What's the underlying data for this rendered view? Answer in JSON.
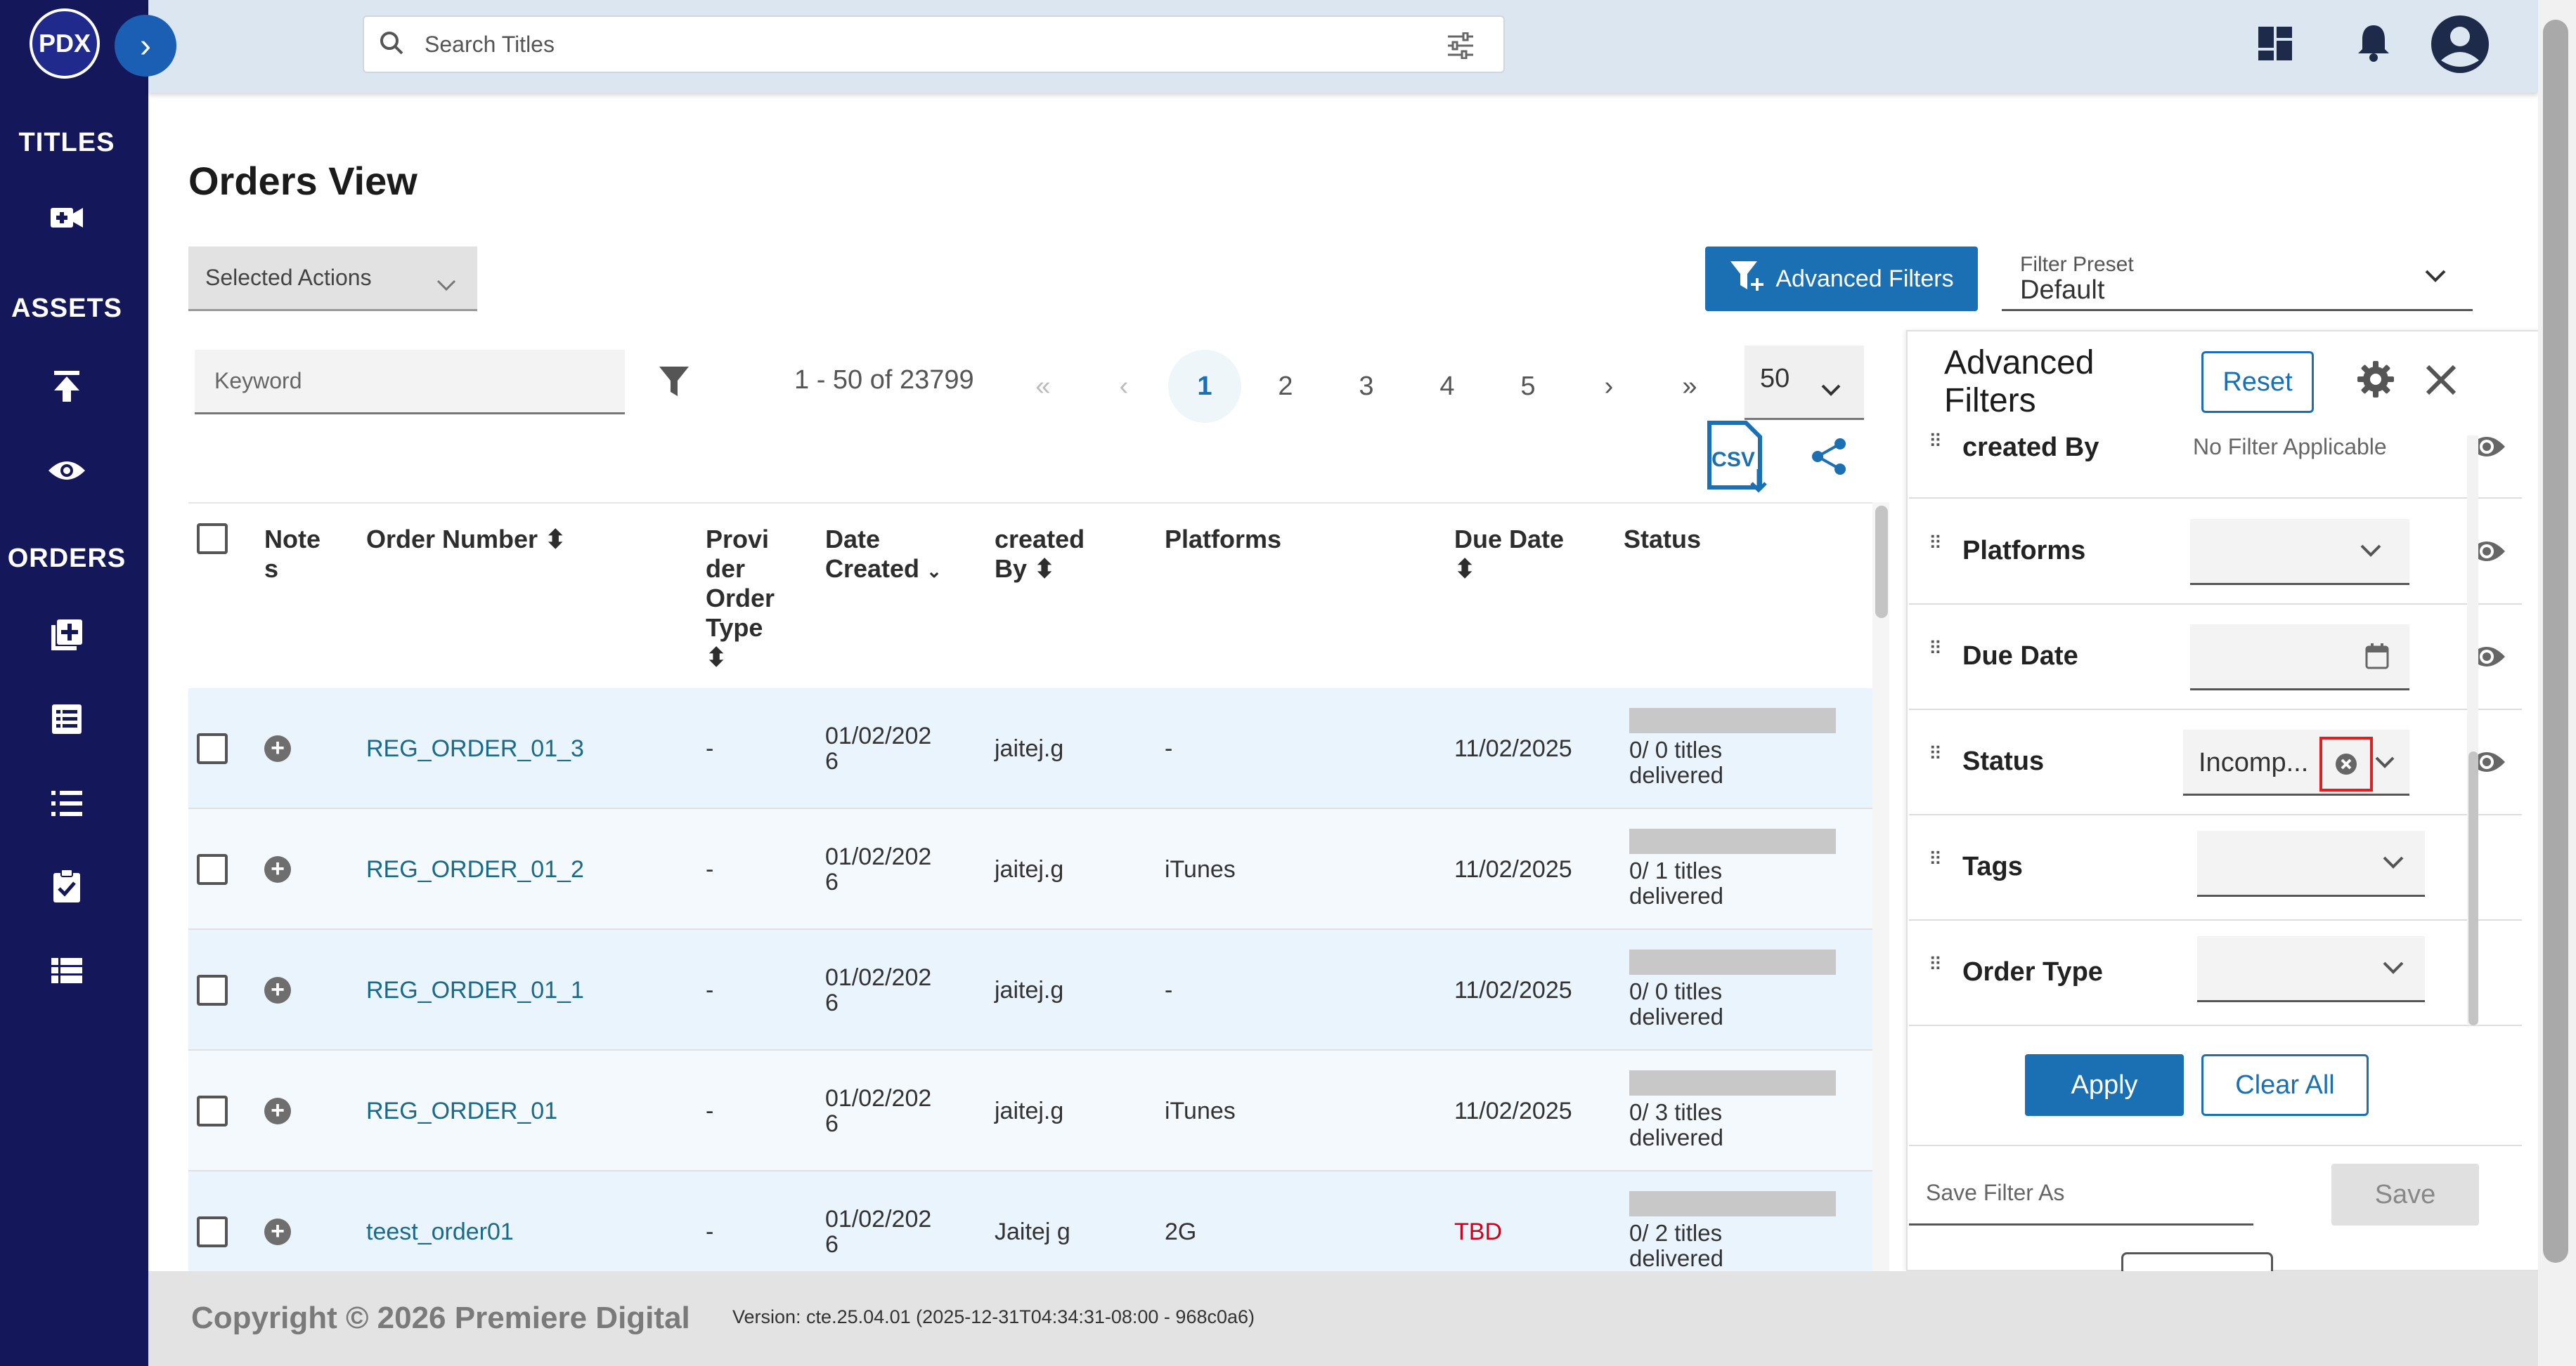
{
  "brand": {
    "logo_text": "PDX"
  },
  "sidebar": {
    "sections": [
      {
        "label": "TITLES"
      },
      {
        "label": "ASSETS"
      },
      {
        "label": "ORDERS"
      }
    ]
  },
  "topbar": {
    "search_placeholder": "Search Titles"
  },
  "page": {
    "title": "Orders View",
    "selected_actions": "Selected Actions",
    "advanced_filters_button": "Advanced Filters",
    "filter_preset_label": "Filter Preset",
    "filter_preset_value": "Default"
  },
  "table_controls": {
    "keyword_placeholder": "Keyword",
    "range": "1 - 50 of 23799",
    "first": "«",
    "prev": "‹",
    "pages": [
      "1",
      "2",
      "3",
      "4",
      "5"
    ],
    "next": "›",
    "last": "»",
    "per_page": "50",
    "csv_label": "CSV"
  },
  "table": {
    "headers": {
      "notes": "Note\ns",
      "order_number": "Order Number",
      "provider_order_type": "Provi\nder\nOrder\nType",
      "date_created": "Date\nCreated",
      "created_by": "created\nBy",
      "platforms": "Platforms",
      "due_date": "Due Date",
      "status": "Status"
    },
    "rows": [
      {
        "order_number": "REG_ORDER_01_3",
        "provider": "-",
        "date": "01/02/202\n6",
        "created_by": "jaitej.g",
        "platforms": "-",
        "due_date": "11/02/2025",
        "status": "0/ 0 titles\ndelivered",
        "due_tbd": false
      },
      {
        "order_number": "REG_ORDER_01_2",
        "provider": "-",
        "date": "01/02/202\n6",
        "created_by": "jaitej.g",
        "platforms": "iTunes",
        "due_date": "11/02/2025",
        "status": "0/ 1 titles\ndelivered",
        "due_tbd": false
      },
      {
        "order_number": "REG_ORDER_01_1",
        "provider": "-",
        "date": "01/02/202\n6",
        "created_by": "jaitej.g",
        "platforms": "-",
        "due_date": "11/02/2025",
        "status": "0/ 0 titles\ndelivered",
        "due_tbd": false
      },
      {
        "order_number": "REG_ORDER_01",
        "provider": "-",
        "date": "01/02/202\n6",
        "created_by": "jaitej.g",
        "platforms": "iTunes",
        "due_date": "11/02/2025",
        "status": "0/ 3 titles\ndelivered",
        "due_tbd": false
      },
      {
        "order_number": "teest_order01",
        "provider": "-",
        "date": "01/02/202\n6",
        "created_by": "Jaitej g",
        "platforms": "2G",
        "due_date": "TBD",
        "status": "0/ 2 titles\ndelivered",
        "due_tbd": true
      }
    ]
  },
  "adv_panel": {
    "title": "Advanced\nFilters",
    "reset": "Reset",
    "filters": [
      {
        "label": "created By",
        "value": "No Filter Applicable",
        "kind": "text"
      },
      {
        "label": "Platforms",
        "value": "",
        "kind": "select"
      },
      {
        "label": "Due Date",
        "value": "",
        "kind": "date"
      },
      {
        "label": "Status",
        "value": "Incomp...",
        "kind": "select-clear"
      },
      {
        "label": "Tags",
        "value": "",
        "kind": "select"
      },
      {
        "label": "Order Type",
        "value": "",
        "kind": "select"
      }
    ],
    "apply": "Apply",
    "clear_all": "Clear All",
    "save_filter_placeholder": "Save Filter As",
    "save": "Save"
  },
  "footer": {
    "copyright": "Copyright © 2026 Premiere Digital",
    "version": "Version: cte.25.04.01 (2025-12-31T04:34:31-08:00 - 968c0a6)"
  },
  "colors": {
    "sidebar": "#14185a",
    "primary": "#1b6fb3",
    "row_alt": "#eaf4fc",
    "tbd": "#d0021b"
  }
}
